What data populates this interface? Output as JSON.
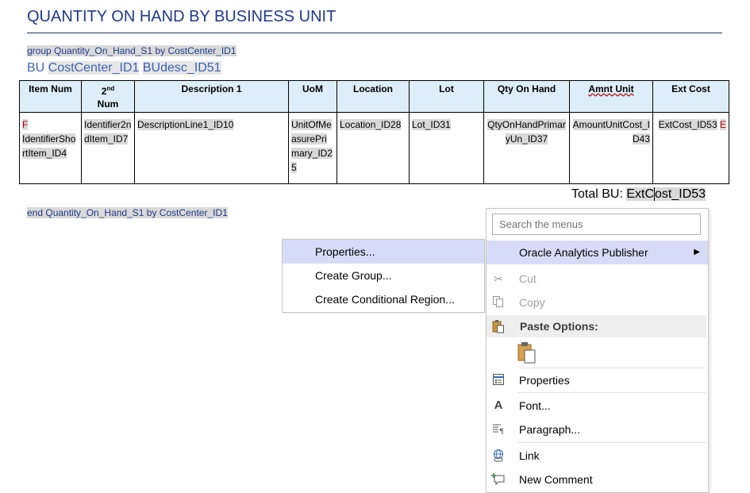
{
  "document": {
    "title": "QUANTITY ON HAND BY BUSINESS UNIT",
    "group_start": "group Quantity_On_Hand_S1 by CostCenter_ID1",
    "bu_prefix": "BU ",
    "bu_field1": "CostCenter_ID1",
    "bu_field2": "BUdesc_ID51",
    "group_end": "end Quantity_On_Hand_S1 by CostCenter_ID1",
    "total_prefix": "Total BU: ",
    "total_field_a": "ExtC",
    "total_field_b": "ost_ID53"
  },
  "table": {
    "headers": [
      "Item Num",
      "2nd Num",
      "Description 1",
      "UoM",
      "Location",
      "Lot",
      "Qty On Hand",
      "Amnt Unit",
      "Ext Cost"
    ],
    "header2_base": "2",
    "header2_sup": "nd",
    "header2_rest": "Num",
    "row": {
      "item_marker": "F",
      "item_num": "IdentifierShortItem_ID4",
      "second_num": "Identifier2ndItem_ID7",
      "description": "DescriptionLine1_ID10",
      "uom": "UnitOfMeasurePrimary_ID25",
      "location": "Location_ID28",
      "lot": "Lot_ID31",
      "qty_on_hand": "QtyOnHandPrimaryUn_ID37",
      "amnt_unit": "AmountUnitCost_ID43",
      "ext_cost": "ExtCost_ID53",
      "ext_marker": "E"
    }
  },
  "mini_menu": {
    "items": [
      "Properties...",
      "Create Group...",
      "Create Conditional Region..."
    ]
  },
  "context_menu": {
    "search_placeholder": "Search the menus",
    "oracle": "Oracle Analytics Publisher",
    "cut": "Cut",
    "copy": "Copy",
    "paste_options": "Paste Options:",
    "properties": "Properties",
    "font": "Font...",
    "paragraph": "Paragraph...",
    "link": "Link",
    "new_comment": "New Comment",
    "icons": [
      "scissors-icon",
      "copy-icon",
      "paste-icon",
      "paste-keep-icon",
      "properties-icon",
      "font-icon",
      "paragraph-icon",
      "link-icon",
      "new-comment-icon"
    ]
  },
  "colors": {
    "title": "#1f3a8a",
    "field_shading": "#d9d9d9",
    "header_fill": "#ddeefa",
    "menu_highlight": "#d6dcf8",
    "form_marker": "#c00000"
  }
}
